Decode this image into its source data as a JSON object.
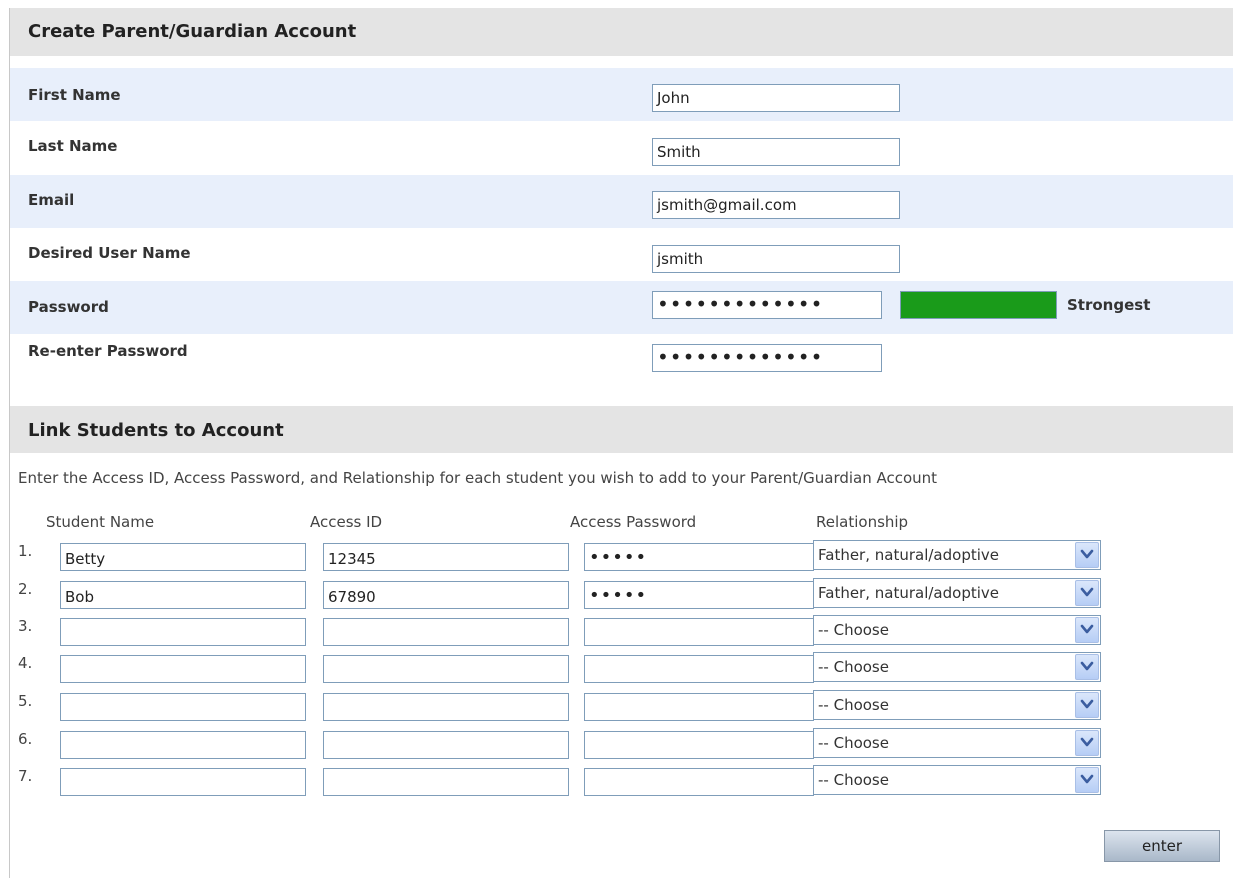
{
  "account": {
    "header": "Create Parent/Guardian Account",
    "fields": [
      {
        "label": "First Name",
        "value": "John"
      },
      {
        "label": "Last Name",
        "value": "Smith"
      },
      {
        "label": "Email",
        "value": "jsmith@gmail.com"
      },
      {
        "label": "Desired User Name",
        "value": "jsmith"
      },
      {
        "label": "Password",
        "value": "•••••••••••••"
      },
      {
        "label": "Re-enter Password",
        "value": "•••••••••••••"
      }
    ],
    "strength": {
      "label": "Strongest",
      "color": "#1a9b1a"
    }
  },
  "link": {
    "header": "Link Students to Account",
    "instructions": "Enter the Access ID, Access Password, and Relationship for each student you wish to add to your Parent/Guardian Account",
    "columns": [
      "Student Name",
      "Access ID",
      "Access Password",
      "Relationship"
    ],
    "rows": [
      {
        "num": "1.",
        "name": "Betty",
        "access_id": "12345",
        "password": "•••••",
        "relationship": "Father, natural/adoptive"
      },
      {
        "num": "2.",
        "name": "Bob",
        "access_id": "67890",
        "password": "•••••",
        "relationship": "Father, natural/adoptive"
      },
      {
        "num": "3.",
        "name": "",
        "access_id": "",
        "password": "",
        "relationship": "-- Choose"
      },
      {
        "num": "4.",
        "name": "",
        "access_id": "",
        "password": "",
        "relationship": "-- Choose"
      },
      {
        "num": "5.",
        "name": "",
        "access_id": "",
        "password": "",
        "relationship": "-- Choose"
      },
      {
        "num": "6.",
        "name": "",
        "access_id": "",
        "password": "",
        "relationship": "-- Choose"
      },
      {
        "num": "7.",
        "name": "",
        "access_id": "",
        "password": "",
        "relationship": "-- Choose"
      }
    ]
  },
  "submit_label": "enter",
  "icons": {
    "dropdown": "chevron-down-icon"
  }
}
